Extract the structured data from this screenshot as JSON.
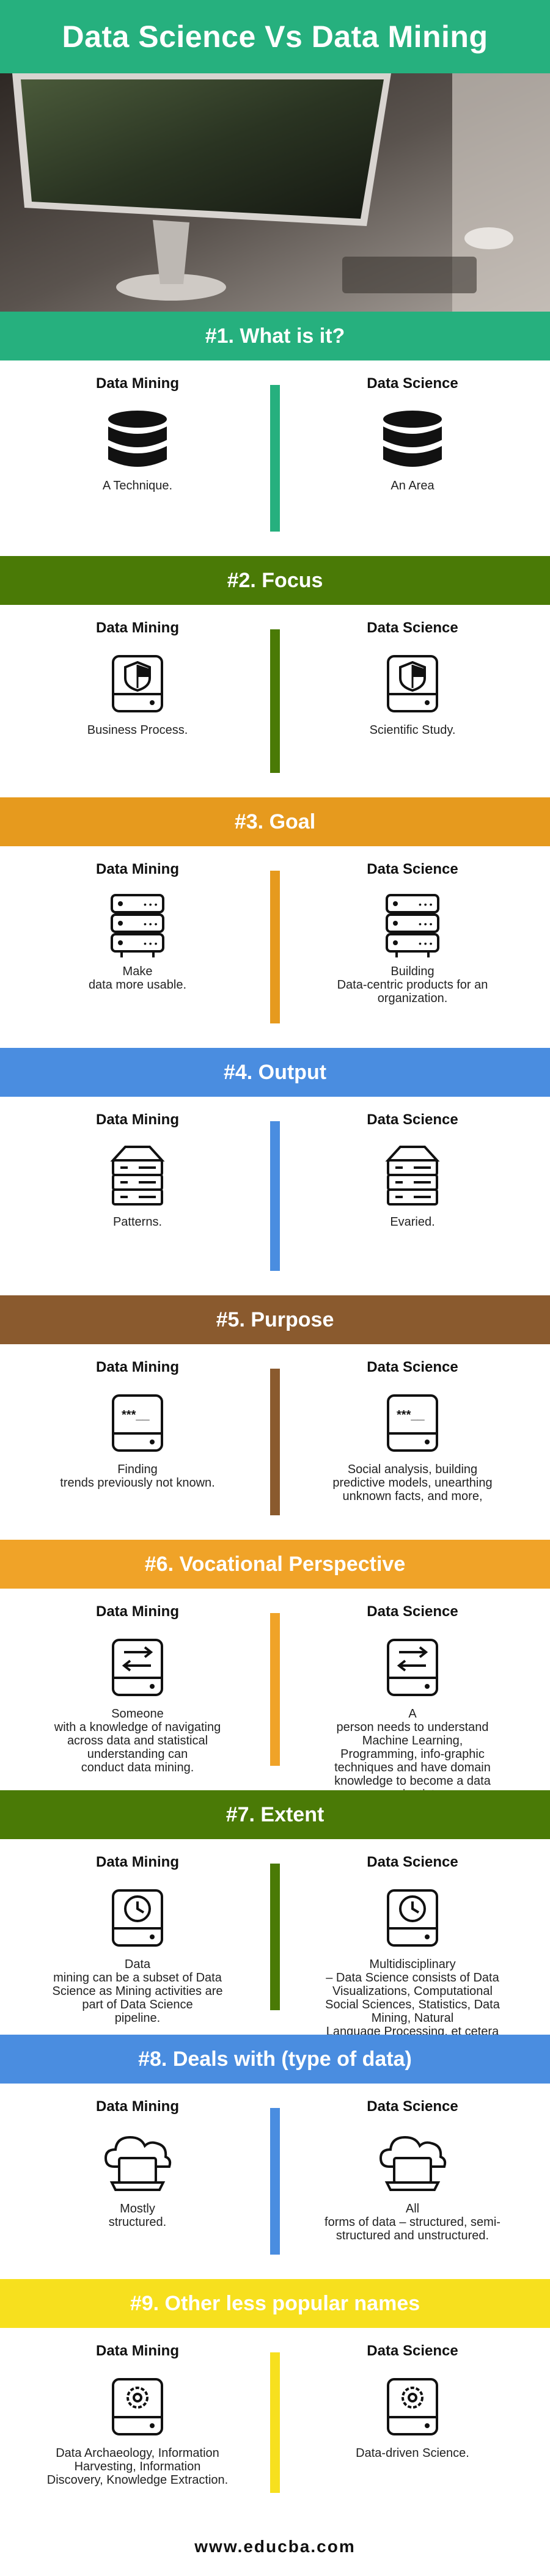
{
  "title": "Data Science Vs Data Mining",
  "footer": "www.educba.com",
  "col_left": "Data Mining",
  "col_right": "Data Science",
  "sections": [
    {
      "heading": "#1. What is it?",
      "color": "#26b07e",
      "icon": "database-icon",
      "left": "A  Technique.",
      "right": "An Area"
    },
    {
      "heading": "#2. Focus",
      "color": "#4a7a06",
      "icon": "shield-drive-icon",
      "left": "Business Process.",
      "right": "Scientific Study."
    },
    {
      "heading": "#3. Goal",
      "color": "#e69a1e",
      "icon": "server-rack-icon",
      "left": "Make\ndata more usable.",
      "right": "Building\nData-centric products for an\norganization."
    },
    {
      "heading": "#4. Output",
      "color": "#4a8de0",
      "icon": "server-stack-icon",
      "left": "Patterns.",
      "right": "Evaried."
    },
    {
      "heading": "#5. Purpose",
      "color": "#8a5a2e",
      "icon": "password-drive-icon",
      "left": "Finding\ntrends previously not known.",
      "right": "Social analysis, building\npredictive models, unearthing\nunknown facts, and more,"
    },
    {
      "heading": "#6. Vocational Perspective",
      "color": "#f0a328",
      "icon": "transfer-drive-icon",
      "left": "Someone\nwith a knowledge of navigating\nacross data and statistical\nunderstanding can\nconduct data mining.",
      "right": "A\nperson needs to understand\nMachine Learning,\nProgramming, info-graphic\ntechniques and have domain\nknowledge to become a data\nscientist"
    },
    {
      "heading": "#7. Extent",
      "color": "#4a7a06",
      "icon": "clock-drive-icon",
      "left": "Data\nmining can be a subset of Data\nScience as Mining activities are\npart of Data Science\npipeline.",
      "right": "Multidisciplinary\n–  Data Science consists of Data\nVisualizations, Computational\nSocial Sciences, Statistics, Data\nMining, Natural\nLanguage Processing, et cetera"
    },
    {
      "heading": "#8. Deals with (type of data)",
      "color": "#4a8de0",
      "icon": "cloud-laptop-icon",
      "left": "Mostly\nstructured.",
      "right": "All\nforms of data – structured, semi-\nstructured and unstructured."
    },
    {
      "heading": "#9. Other less popular names",
      "color": "#f7e01e",
      "icon": "gear-drive-icon",
      "left": "Data Archaeology, Information\nHarvesting, Information\nDiscovery, Knowledge Extraction.",
      "right": "Data-driven Science."
    }
  ]
}
